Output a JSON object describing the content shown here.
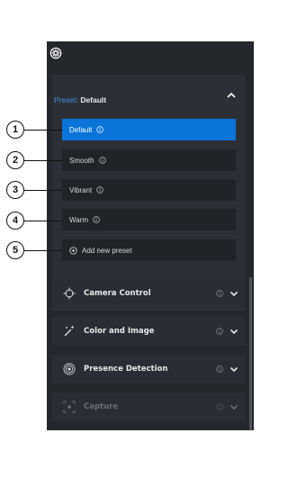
{
  "preset": {
    "label": "Preset:",
    "current": "Default",
    "options": [
      {
        "label": "Default",
        "selected": true
      },
      {
        "label": "Smooth",
        "selected": false
      },
      {
        "label": "Vibrant",
        "selected": false
      },
      {
        "label": "Warm",
        "selected": false
      }
    ],
    "add_label": "Add new preset"
  },
  "sections": [
    {
      "label": "Camera Control",
      "icon": "crosshair-icon"
    },
    {
      "label": "Color and Image",
      "icon": "magic-wand-icon"
    },
    {
      "label": "Presence Detection",
      "icon": "presence-icon"
    },
    {
      "label": "Capture",
      "icon": "capture-icon",
      "dimmed": true
    }
  ],
  "callouts": [
    "1",
    "2",
    "3",
    "4",
    "5"
  ],
  "colors": {
    "accent": "#0a74d9",
    "panel_bg": "#24272c",
    "link_blue": "#3f8ce0"
  }
}
